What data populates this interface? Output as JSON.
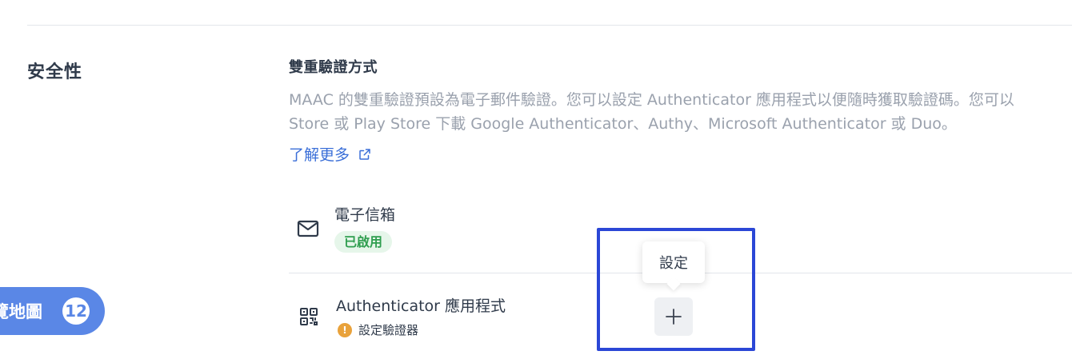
{
  "section": {
    "title": "安全性"
  },
  "mfa": {
    "title": "雙重驗證方式",
    "description_line1": "MAAC 的雙重驗證預設為電子郵件驗證。您可以設定 Authenticator 應用程式以便隨時獲取驗證碼。您可以",
    "description_line2": "Store 或 Play Store 下載 Google Authenticator、Authy、Microsoft Authenticator 或 Duo。",
    "learn_more": "了解更多",
    "learn_more_icon": "external-link-icon"
  },
  "methods": {
    "email": {
      "name": "電子信箱",
      "status": "已啟用",
      "icon": "mail-icon",
      "status_color": "#2f9e4f"
    },
    "authenticator": {
      "name": "Authenticator 應用程式",
      "status": "設定驗證器",
      "icon": "qr-code-icon",
      "status_icon": "warning-icon",
      "status_color": "#e9a23b"
    }
  },
  "action": {
    "tooltip": "設定",
    "add_icon": "plus-icon",
    "highlight_color": "#2b47d6"
  },
  "tour": {
    "label": "覽地圖",
    "count": "12",
    "color": "#5a87e6"
  }
}
